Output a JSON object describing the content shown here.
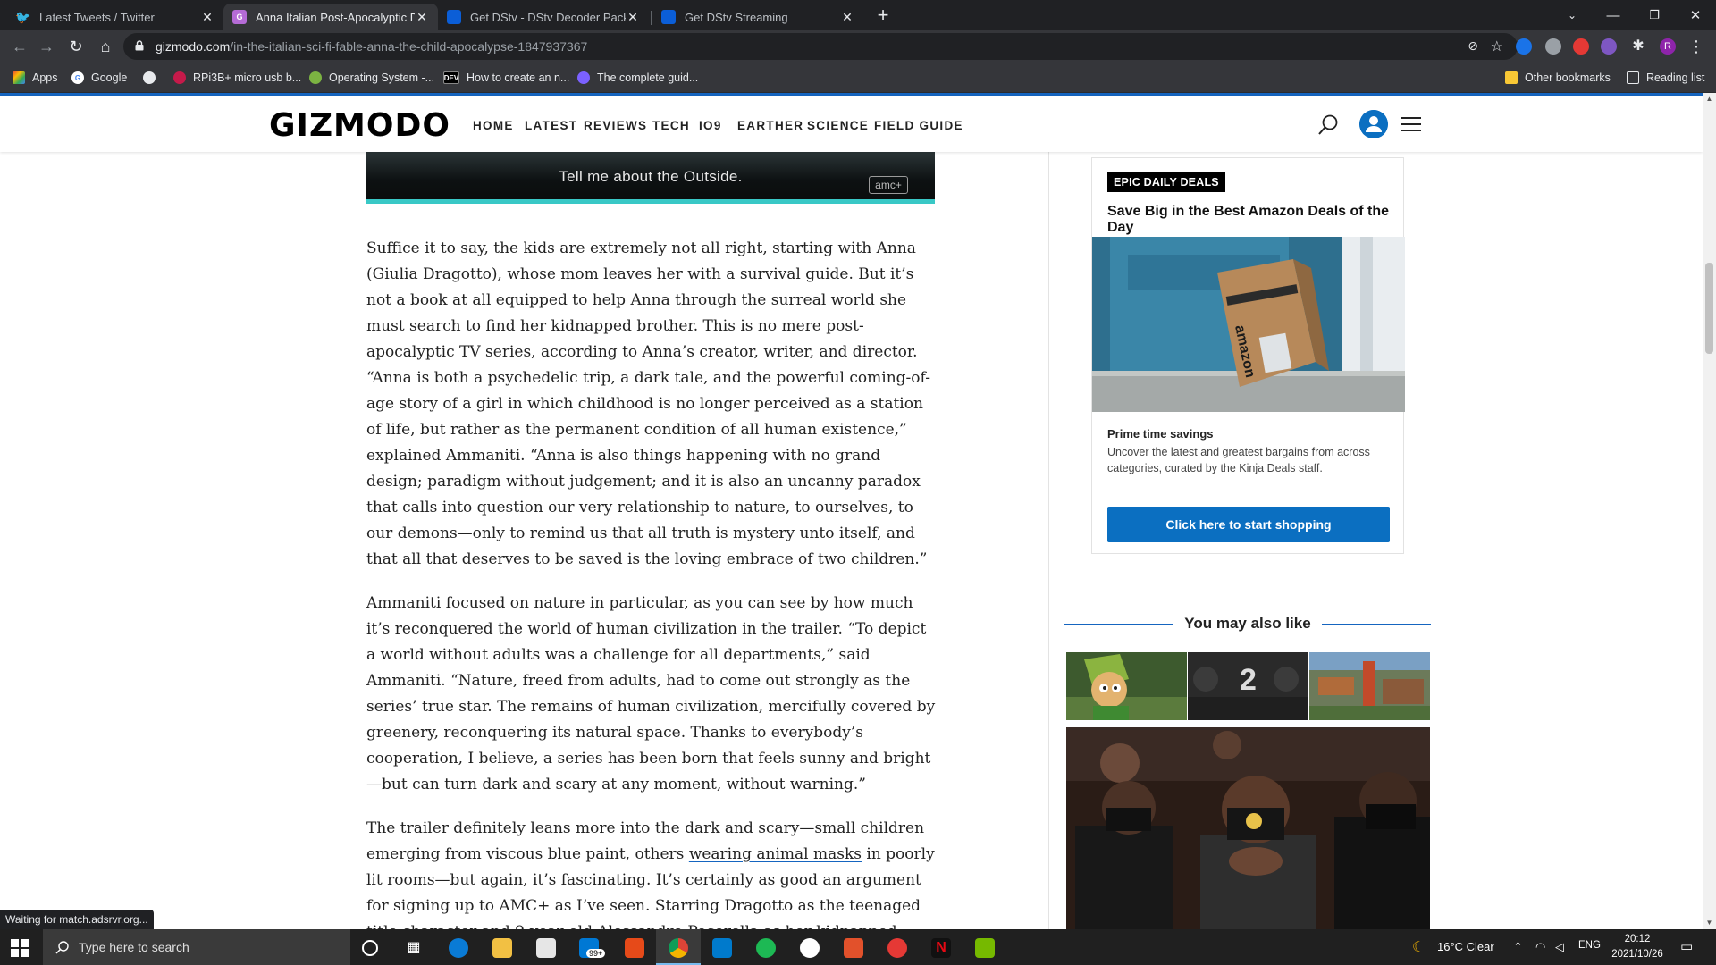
{
  "browser": {
    "tabs": [
      {
        "title": "Latest Tweets / Twitter",
        "active": false,
        "favicon": "twitter-bird-icon"
      },
      {
        "title": "Anna Italian Post-Apocalyptic Dr",
        "active": true,
        "favicon": "gizmodo-icon"
      },
      {
        "title": "Get DStv - DStv Decoder Package",
        "active": false,
        "favicon": "dstv-icon"
      },
      {
        "title": "Get DStv Streaming",
        "active": false,
        "favicon": "dstv-icon"
      }
    ],
    "url_host": "gizmodo.com",
    "url_path": "/in-the-italian-sci-fi-fable-anna-the-child-apocalypse-1847937367",
    "profile_initial": "R",
    "bookmarks": [
      {
        "label": "Apps",
        "icon": "apps-grid-icon"
      },
      {
        "label": "Google",
        "icon": "google-icon"
      },
      {
        "label": "",
        "icon": "globe-icon"
      },
      {
        "label": "RPi3B+ micro usb b...",
        "icon": "raspberry-pi-icon"
      },
      {
        "label": "Operating System -...",
        "icon": "site-icon"
      },
      {
        "label": "How to create an n...",
        "icon": "dev-icon"
      },
      {
        "label": "The complete guid...",
        "icon": "site-icon"
      }
    ],
    "other_bookmarks": "Other bookmarks",
    "reading_list": "Reading list",
    "status_text": "Waiting for match.adsrvr.org..."
  },
  "site": {
    "logo": "GIZMODO",
    "nav": [
      "HOME",
      "LATEST",
      "REVIEWS",
      "TECH",
      "IO9",
      "EARTHER",
      "SCIENCE",
      "FIELD GUIDE"
    ]
  },
  "video": {
    "caption": "Tell me about the Outside.",
    "watermark": "amc+"
  },
  "article": {
    "p1": "Suffice it to say, the kids are extremely not all right, starting with Anna (Giulia Dragotto), whose mom leaves her with a survival guide. But it’s not a book at all equipped to help Anna through the surreal world she must search to find her kidnapped brother. This is no mere post-apocalyptic TV series, according to Anna’s creator, writer, and director. “Anna is both a psychedelic trip, a dark tale, and the powerful coming-of-age story of a girl in which childhood is no longer perceived as a station of life, but rather as the permanent condition of all human existence,” explained Ammaniti. “Anna is also things happening with no grand design; paradigm without judgement; and it is also an uncanny paradox that calls into question our very relationship to nature, to ourselves, to our demons—only to remind us that all truth is mystery unto itself, and that all that deserves to be saved is the loving embrace of two children.”",
    "p2": "Ammaniti focused on nature in particular, as you can see by how much it’s reconquered the world of human civilization in the trailer. “To depict a world without adults was a challenge for all departments,” said Ammaniti. “Nature, freed from adults, had to come out strongly as the series’ true star. The remains of human civilization, mercifully covered by greenery, reconquering its natural space. Thanks to everybody’s cooperation, I believe, a series has been born that feels sunny and bright—but can turn dark and scary at any moment, without warning.”",
    "p3_before_link": "The trailer definitely leans more into the dark and scary—small children emerging from viscous blue paint, others ",
    "p3_link": "wearing animal masks",
    "p3_after_link": " in poorly lit rooms—but again, it’s fascinating. It’s certainly as good an argument for signing up to AMC+ as I’ve seen. Starring Dragotto as the teenaged title character and 9-year-old Alessandro Pecorella as her kidnapped brother Astor, both of whom"
  },
  "deals": {
    "badge": "EPIC DAILY DEALS",
    "headline": "Save Big in the Best Amazon Deals of the Day",
    "subhead": "Prime time savings",
    "description": "Uncover the latest and greatest bargains from across categories, curated by the Kinja Deals staff.",
    "cta": "Click here to start shopping",
    "package_text": "amazon"
  },
  "related": {
    "heading": "You may also like",
    "thumb_badge": "2"
  },
  "taskbar": {
    "search_placeholder": "Type here to search",
    "mail_badge": "99+",
    "weather": "16°C  Clear",
    "language": "ENG",
    "time": "20:12",
    "date": "2021/10/26"
  },
  "colors": {
    "accent": "#1565c0",
    "cta": "#0b6fc1",
    "video_bar": "#39c8c6"
  }
}
